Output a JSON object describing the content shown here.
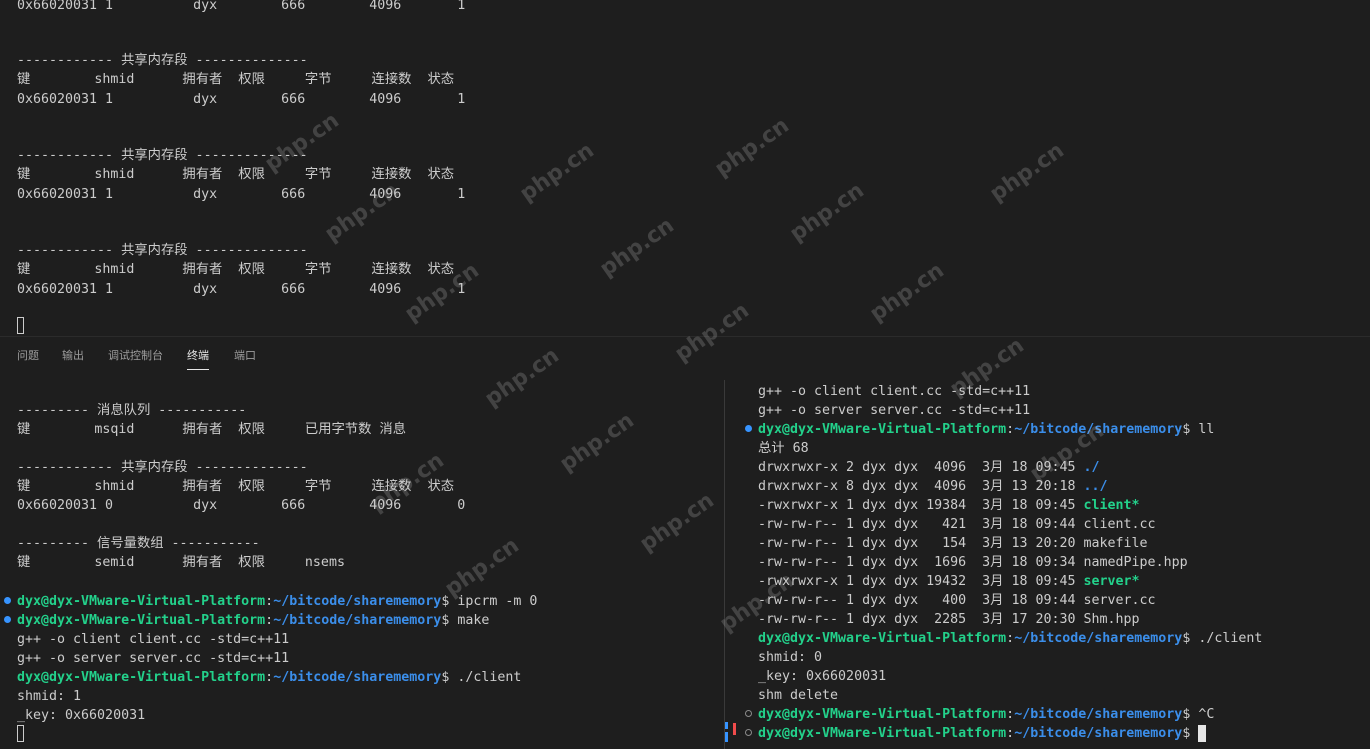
{
  "top_terminal": {
    "lines": [
      "0x66020031 1          dyx        666        4096       1",
      "",
      "",
      "------------ 共享内存段 --------------",
      "键        shmid      拥有者  权限     字节     连接数  状态",
      "0x66020031 1          dyx        666        4096       1",
      "",
      "",
      "------------ 共享内存段 --------------",
      "键        shmid      拥有者  权限     字节     连接数  状态",
      "0x66020031 1          dyx        666        4096       1",
      "",
      "",
      "------------ 共享内存段 --------------",
      "键        shmid      拥有者  权限     字节     连接数  状态",
      "0x66020031 1          dyx        666        4096       1"
    ]
  },
  "panel_tabs": [
    {
      "label": "问题"
    },
    {
      "label": "输出"
    },
    {
      "label": "调试控制台"
    },
    {
      "label": "终端"
    },
    {
      "label": "端口"
    }
  ],
  "left_pane": {
    "lines": [
      "--------- 消息队列 -----------",
      "键        msqid      拥有者  权限     已用字节数 消息",
      "",
      "------------ 共享内存段 --------------",
      "键        shmid      拥有者  权限     字节     连接数  状态",
      "0x66020031 0          dyx        666        4096       0",
      "",
      "--------- 信号量数组 -----------",
      "键        semid      拥有者  权限     nsems"
    ],
    "prompt_user": "dyx@dyx-VMware-Virtual-Platform",
    "prompt_path": "~/bitcode/sharememory",
    "cmd1": " ipcrm -m 0",
    "cmd2": " make",
    "make1": "g++ -o client client.cc -std=c++11",
    "make2": "g++ -o server server.cc -std=c++11",
    "cmd3": " ./client",
    "out1": "shmid: 1",
    "out2": "_key: 0x66020031"
  },
  "right_pane": {
    "pre1": "g++ -o client client.cc -std=c++11",
    "pre2": "g++ -o server server.cc -std=c++11",
    "prompt_user": "dyx@dyx-VMware-Virtual-Platform",
    "prompt_path": "~/bitcode/sharememory",
    "cmd_ll": " ll",
    "total": "总计 68",
    "listing": [
      {
        "meta": "drwxrwxr-x 2 dyx dyx  4096  3月 18 09:45 ",
        "name": "./",
        "kind": "dir"
      },
      {
        "meta": "drwxrwxr-x 8 dyx dyx  4096  3月 13 20:18 ",
        "name": "../",
        "kind": "dir"
      },
      {
        "meta": "-rwxrwxr-x 1 dyx dyx 19384  3月 18 09:45 ",
        "name": "client*",
        "kind": "exec"
      },
      {
        "meta": "-rw-rw-r-- 1 dyx dyx   421  3月 18 09:44 ",
        "name": "client.cc",
        "kind": "file"
      },
      {
        "meta": "-rw-rw-r-- 1 dyx dyx   154  3月 13 20:20 ",
        "name": "makefile",
        "kind": "file"
      },
      {
        "meta": "-rw-rw-r-- 1 dyx dyx  1696  3月 18 09:34 ",
        "name": "namedPipe.hpp",
        "kind": "file"
      },
      {
        "meta": "-rwxrwxr-x 1 dyx dyx 19432  3月 18 09:45 ",
        "name": "server*",
        "kind": "exec"
      },
      {
        "meta": "-rw-rw-r-- 1 dyx dyx   400  3月 18 09:44 ",
        "name": "server.cc",
        "kind": "file"
      },
      {
        "meta": "-rw-rw-r-- 1 dyx dyx  2285  3月 17 20:30 ",
        "name": "Shm.hpp",
        "kind": "file"
      }
    ],
    "cmd_client": " ./client",
    "out1": "shmid: 0",
    "out2": "_key: 0x66020031",
    "out3": "shm delete",
    "cmd_ctrlc": " ^C"
  },
  "colors": {
    "background": "#1e1e1e",
    "text": "#cccccc",
    "prompt_user": "#23d18b",
    "prompt_path": "#3b8eea",
    "decoration_blue": "#3794ff",
    "decoration_red": "#f14c4c"
  },
  "watermark_text": "php.cn"
}
